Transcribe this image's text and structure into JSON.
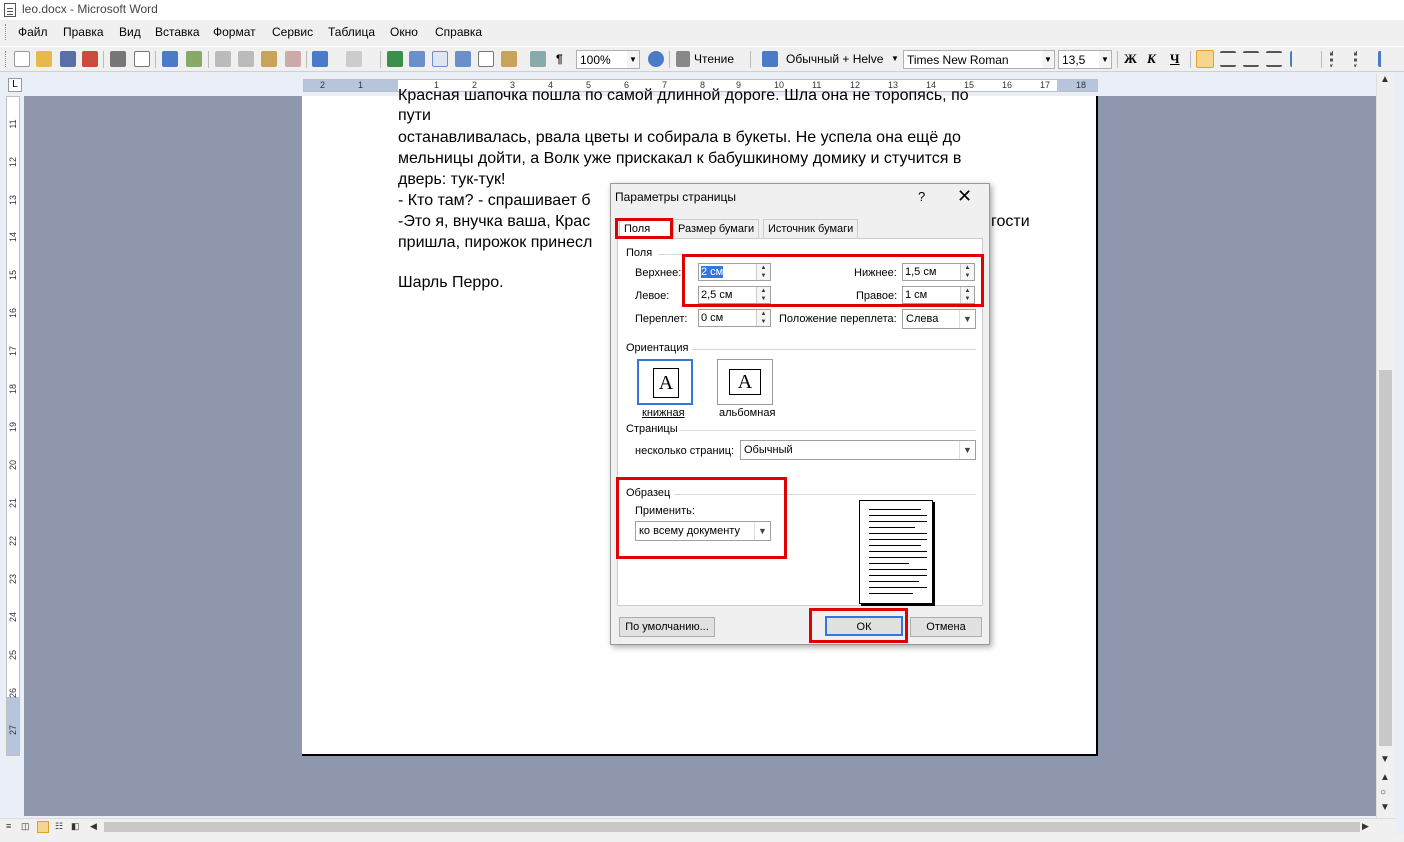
{
  "window": {
    "title": "leo.docx - Microsoft Word"
  },
  "menu": [
    {
      "label": "Файл"
    },
    {
      "label": "Правка"
    },
    {
      "label": "Вид"
    },
    {
      "label": "Вставка"
    },
    {
      "label": "Формат"
    },
    {
      "label": "Сервис"
    },
    {
      "label": "Таблица"
    },
    {
      "label": "Окно"
    },
    {
      "label": "Справка"
    }
  ],
  "toolbar": {
    "zoom": "100%",
    "reading": "Чтение",
    "style": "Обычный + Helve",
    "font": "Times New Roman",
    "size": "13,5",
    "bold": "Ж",
    "italic": "К",
    "underline": "Ч"
  },
  "ruler": {
    "top_numbers": [
      "2",
      "1",
      "1",
      "2",
      "3",
      "4",
      "5",
      "6",
      "7",
      "8",
      "9",
      "10",
      "11",
      "12",
      "13",
      "14",
      "15",
      "16",
      "17",
      "18"
    ],
    "left_numbers": [
      "11",
      "12",
      "13",
      "14",
      "15",
      "16",
      "17",
      "18",
      "19",
      "20",
      "21",
      "22",
      "23",
      "24",
      "25",
      "26",
      "27"
    ]
  },
  "document": {
    "lines": [
      "Красная шапочка пошла по самой длинной дороге. Шла она не торопясь, по",
      "пути",
      "останавливалась, рвала цветы и собирала в букеты. Не успела она ещё до",
      "мельницы дойти, а Волк уже прискакал к бабушкиному домику и стучится в",
      "дверь: тук-тук!",
      "- Кто там? - спрашивает б",
      "-Это я, внучка ваша, Крас",
      "пришла, пирожок принесл",
      "",
      "Шарль Перро."
    ],
    "line_right_fragment": "гости"
  },
  "dialog": {
    "title": "Параметры страницы",
    "help": "?",
    "close": "✕",
    "tabs": [
      {
        "label": "Поля"
      },
      {
        "label": "Размер бумаги"
      },
      {
        "label": "Источник бумаги"
      }
    ],
    "margins": {
      "group": "Поля",
      "top_label": "Верхнее:",
      "top_value": "2 см",
      "bottom_label": "Нижнее:",
      "bottom_value": "1,5 см",
      "left_label": "Левое:",
      "left_value": "2,5 см",
      "right_label": "Правое:",
      "right_value": "1 см",
      "gutter_label": "Переплет:",
      "gutter_value": "0 см",
      "gutter_pos_label": "Положение переплета:",
      "gutter_pos_value": "Слева"
    },
    "orientation": {
      "group": "Ориентация",
      "portrait": "книжная",
      "landscape": "альбомная",
      "glyph": "A"
    },
    "pages": {
      "group": "Страницы",
      "label": "несколько страниц:",
      "value": "Обычный"
    },
    "preview": {
      "group": "Образец",
      "apply_label": "Применить:",
      "apply_value": "ко всему документу"
    },
    "buttons": {
      "default": "По умолчанию...",
      "ok": "ОК",
      "cancel": "Отмена"
    }
  },
  "colors": {
    "highlight": "#e00000",
    "workspace": "#8e97ad",
    "selection": "#3377dd"
  }
}
